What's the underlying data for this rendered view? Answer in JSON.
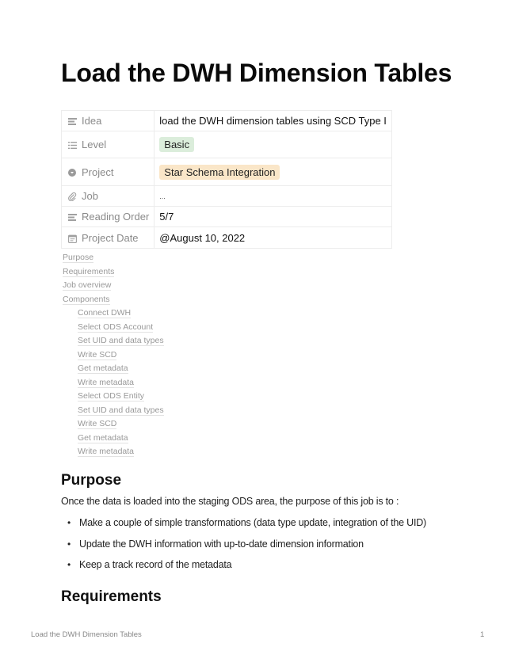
{
  "page": {
    "title": "Load the DWH Dimension Tables"
  },
  "properties": [
    {
      "icon": "text-lines-icon",
      "key": "Idea",
      "value": "load the DWH dimension tables using SCD Type I"
    },
    {
      "icon": "list-icon",
      "key": "Level",
      "value": "Basic",
      "tag_color": "#dbeddb"
    },
    {
      "icon": "circle-select-icon",
      "key": "Project",
      "value": "Star Schema Integration",
      "tag_color": "#fae6c8"
    },
    {
      "icon": "paperclip-icon",
      "key": "Job",
      "value": "..."
    },
    {
      "icon": "text-lines-icon",
      "key": "Reading Order",
      "value": "5/7"
    },
    {
      "icon": "calendar-icon",
      "key": "Project Date",
      "value": "@August 10, 2022"
    }
  ],
  "toc": [
    {
      "label": "Purpose",
      "level": 1
    },
    {
      "label": "Requirements",
      "level": 1
    },
    {
      "label": "Job overview",
      "level": 1
    },
    {
      "label": "Components",
      "level": 1
    },
    {
      "label": "Connect DWH",
      "level": 2
    },
    {
      "label": "Select ODS Account",
      "level": 2
    },
    {
      "label": "Set UID and data types",
      "level": 2
    },
    {
      "label": "Write SCD",
      "level": 2
    },
    {
      "label": "Get metadata",
      "level": 2
    },
    {
      "label": "Write metadata",
      "level": 2
    },
    {
      "label": "Select ODS Entity",
      "level": 2
    },
    {
      "label": "Set UID and data types",
      "level": 2
    },
    {
      "label": "Write SCD",
      "level": 2
    },
    {
      "label": "Get metadata",
      "level": 2
    },
    {
      "label": "Write metadata",
      "level": 2
    }
  ],
  "purpose": {
    "heading": "Purpose",
    "intro": "Once the data is loaded into the staging ODS area, the purpose of this job is to :",
    "bullets": [
      "Make a couple of simple transformations (data type update, integration of the UID)",
      "Update the DWH information with up-to-date dimension information",
      "Keep a track record of the metadata"
    ]
  },
  "requirements": {
    "heading": "Requirements"
  },
  "footer": {
    "title": "Load the DWH Dimension Tables",
    "page_number": "1"
  }
}
